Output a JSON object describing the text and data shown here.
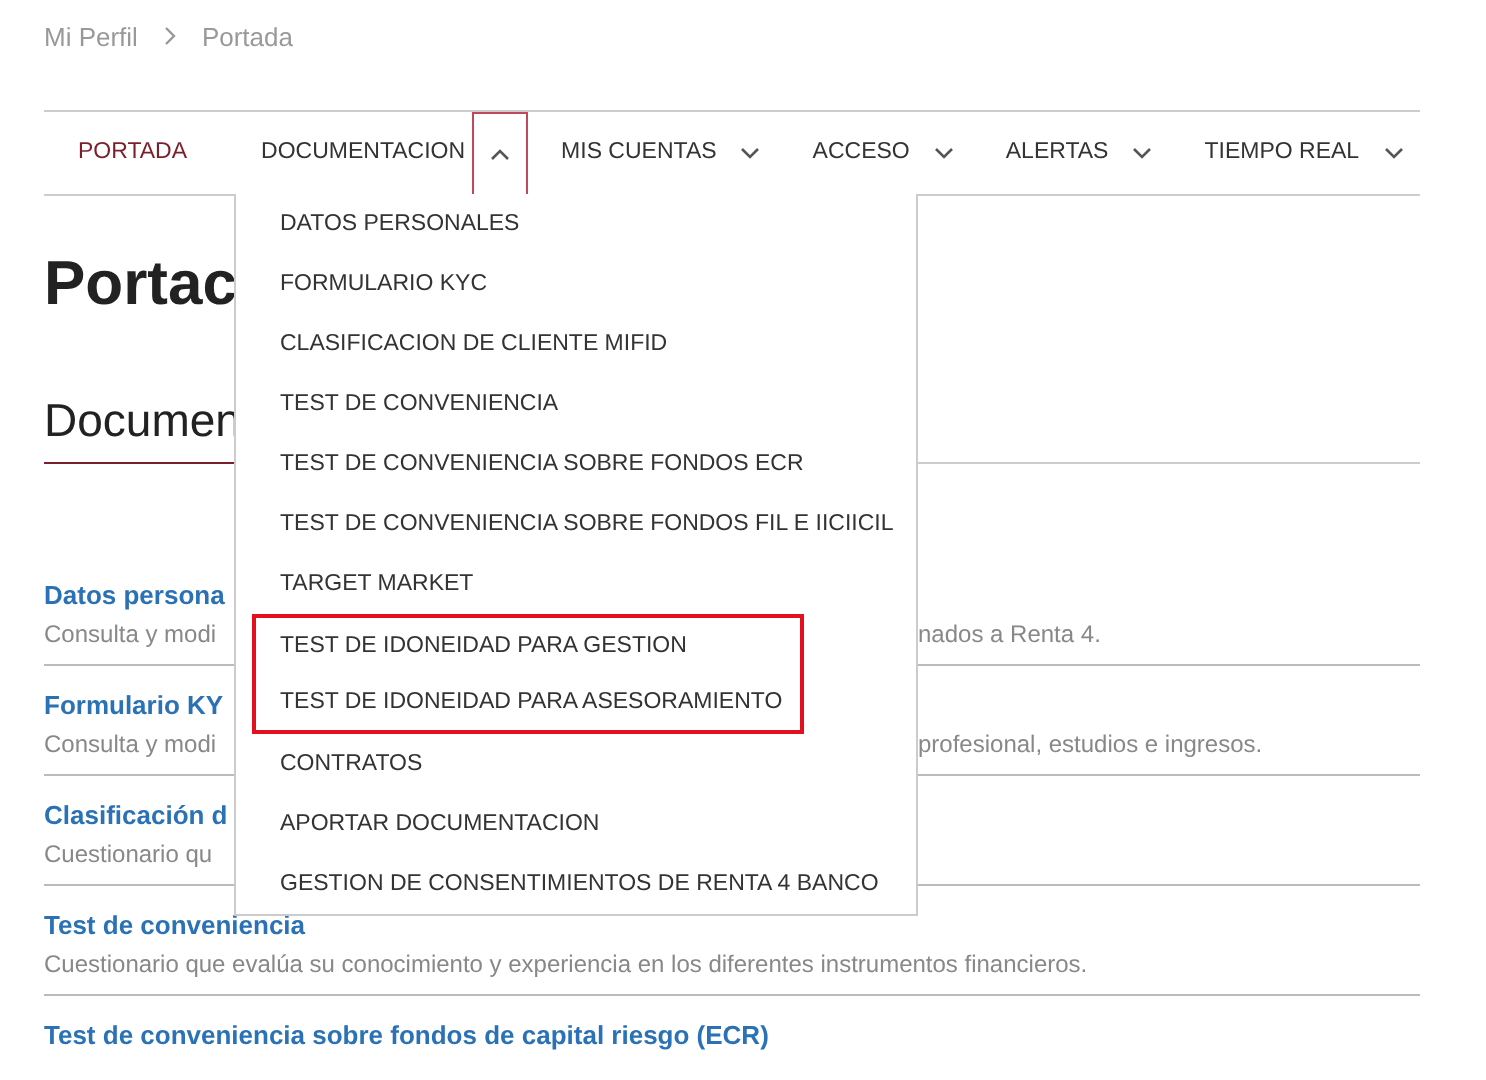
{
  "breadcrumb": [
    {
      "label": "Mi Perfil"
    },
    {
      "label": "Portada"
    }
  ],
  "nav": [
    {
      "label": "PORTADA",
      "selected": true
    },
    {
      "label": "DOCUMENTACION",
      "selected": false,
      "expanded": true
    },
    {
      "label": "MIS CUENTAS",
      "selected": false,
      "expanded": false
    },
    {
      "label": "ACCESO",
      "selected": false,
      "expanded": false
    },
    {
      "label": "ALERTAS",
      "selected": false,
      "expanded": false
    },
    {
      "label": "TIEMPO REAL",
      "selected": false,
      "expanded": false
    }
  ],
  "dropdown": [
    {
      "label": "DATOS PERSONALES",
      "highlighted": false
    },
    {
      "label": "FORMULARIO KYC",
      "highlighted": false
    },
    {
      "label": "CLASIFICACION DE CLIENTE MIFID",
      "highlighted": false
    },
    {
      "label": "TEST DE CONVENIENCIA",
      "highlighted": false
    },
    {
      "label": "TEST DE CONVENIENCIA SOBRE FONDOS ECR",
      "highlighted": false
    },
    {
      "label": "TEST DE CONVENIENCIA SOBRE FONDOS FIL E IICIICIL",
      "highlighted": false
    },
    {
      "label": "TARGET MARKET",
      "highlighted": false
    },
    {
      "label": "TEST DE IDONEIDAD PARA GESTION",
      "highlighted": true
    },
    {
      "label": "TEST DE IDONEIDAD PARA ASESORAMIENTO",
      "highlighted": true
    },
    {
      "label": "CONTRATOS",
      "highlighted": false
    },
    {
      "label": "APORTAR DOCUMENTACION",
      "highlighted": false
    },
    {
      "label": "GESTION DE CONSENTIMIENTOS DE RENTA 4 BANCO",
      "highlighted": false
    }
  ],
  "page_title": "Portac",
  "section_title": "Documen",
  "documents": [
    {
      "title": "Datos persona",
      "description": "Consulta y modi",
      "description_right": "nados a Renta 4."
    },
    {
      "title": "Formulario KY",
      "description": "Consulta y modi",
      "description_right": "profesional, estudios e ingresos."
    },
    {
      "title": "Clasificación d",
      "description": "Cuestionario qu"
    },
    {
      "title": "Test de conveniencia",
      "description": "Cuestionario que evalúa su conocimiento y experiencia en los diferentes instrumentos financieros."
    },
    {
      "title": "Test de conveniencia sobre fondos de capital riesgo (ECR)"
    }
  ]
}
